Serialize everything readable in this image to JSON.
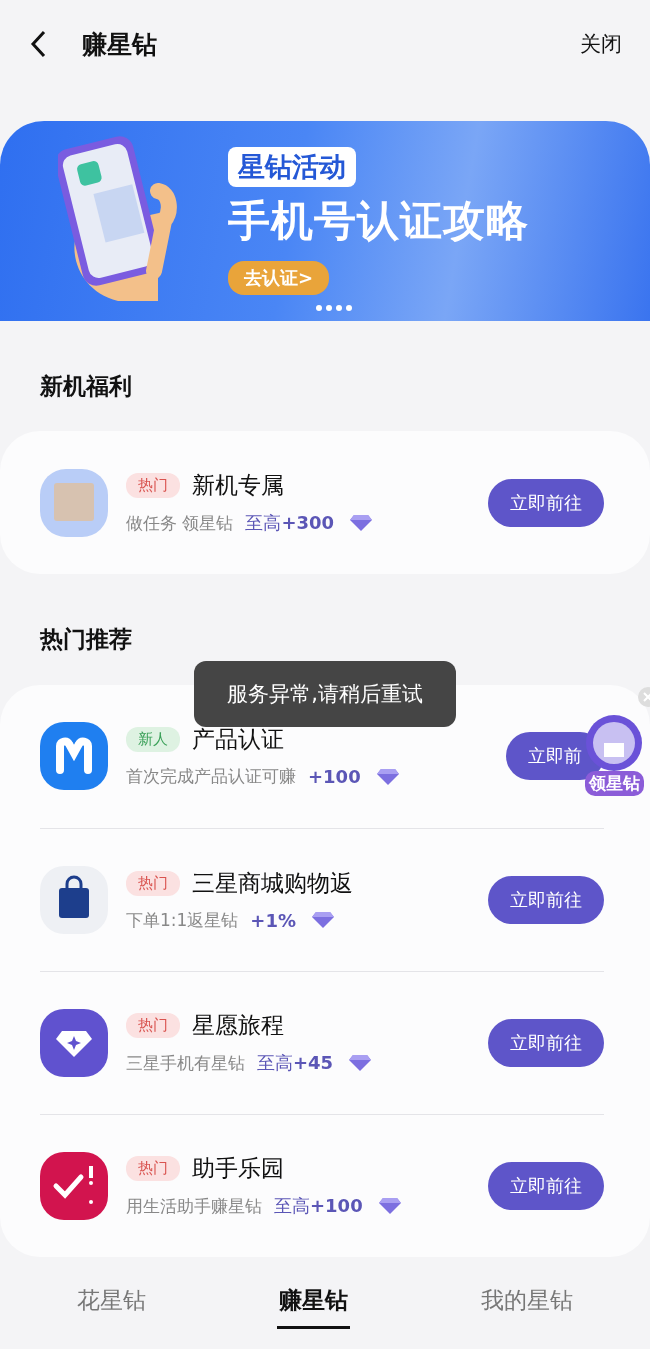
{
  "header": {
    "title": "赚星钻",
    "close": "关闭"
  },
  "banner": {
    "tag": "星钻活动",
    "headline": "手机号认证攻略",
    "cta": "去认证>"
  },
  "sections": [
    {
      "title": "新机福利",
      "tasks": [
        {
          "kind": "phone-photo",
          "tag": {
            "kind": "hot",
            "text": "热门"
          },
          "name": "新机专属",
          "desc": "做任务 领星钻",
          "reward": "至高**+300**",
          "button": "立即前往"
        }
      ]
    },
    {
      "title": "热门推荐",
      "tasks": [
        {
          "kind": "m-app",
          "tag": {
            "kind": "new",
            "text": "新人"
          },
          "name": "产品认证",
          "desc": "首次完成产品认证可赚",
          "reward": "**+100**",
          "button": "立即前"
        },
        {
          "kind": "bag",
          "tag": {
            "kind": "hot",
            "text": "热门"
          },
          "name": "三星商城购物返",
          "desc": "下单1:1返星钻",
          "reward": "**+1%**",
          "button": "立即前往"
        },
        {
          "kind": "diamond",
          "tag": {
            "kind": "hot",
            "text": "热门"
          },
          "name": "星愿旅程",
          "desc": "三星手机有星钻",
          "reward": "至高**+45**",
          "button": "立即前往"
        },
        {
          "kind": "check",
          "tag": {
            "kind": "hot",
            "text": "热门"
          },
          "name": "助手乐园",
          "desc": "用生活助手赚星钻",
          "reward": "至高**+100**",
          "button": "立即前往"
        }
      ]
    }
  ],
  "toast": "服务异常,请稍后重试",
  "floating_widget": {
    "label": "领星钻"
  },
  "tabs": [
    {
      "label": "花星钻",
      "selected": false
    },
    {
      "label": "赚星钻",
      "selected": true
    },
    {
      "label": "我的星钻",
      "selected": false
    }
  ]
}
